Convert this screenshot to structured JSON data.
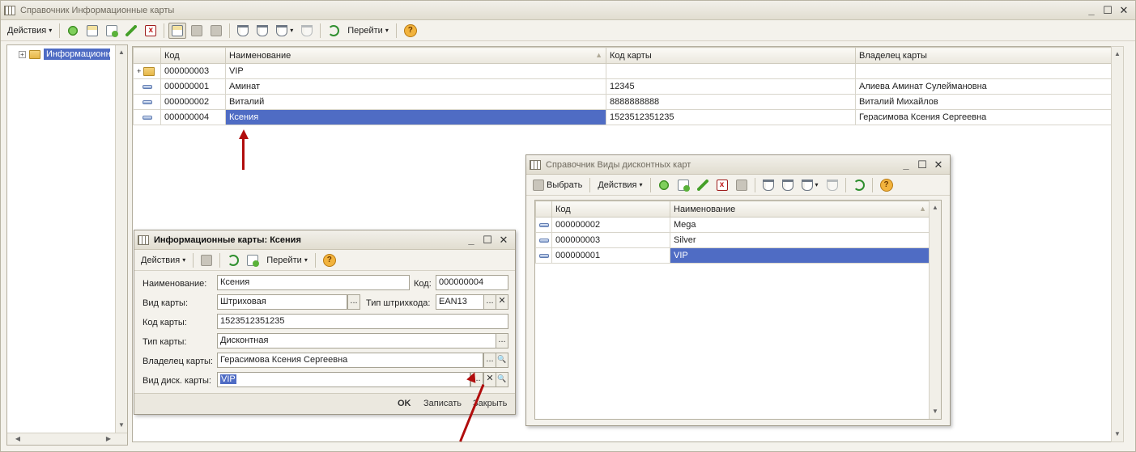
{
  "main": {
    "title": "Справочник Информационные карты",
    "toolbar": {
      "actions_label": "Действия",
      "goto_label": "Перейти",
      "help": "?"
    },
    "tree": {
      "item_label": "Информационные карты",
      "plus": "+"
    },
    "table": {
      "headers": {
        "code": "Код",
        "name": "Наименование",
        "card_code": "Код карты",
        "owner": "Владелец карты"
      },
      "rows": [
        {
          "code": "000000003",
          "name": "VIP",
          "card_code": "",
          "owner": ""
        },
        {
          "code": "000000001",
          "name": "Аминат",
          "card_code": "12345",
          "owner": "Алиева Аминат Сулеймановна"
        },
        {
          "code": "000000002",
          "name": "Виталий",
          "card_code": "8888888888",
          "owner": "Виталий Михайлов"
        },
        {
          "code": "000000004",
          "name": "Ксения",
          "card_code": "1523512351235",
          "owner": "Герасимова Ксения Сергеевна"
        }
      ]
    }
  },
  "form": {
    "title": "Информационные карты: Ксения",
    "toolbar": {
      "actions_label": "Действия",
      "goto_label": "Перейти",
      "help": "?"
    },
    "fields": {
      "name_label": "Наименование:",
      "name_value": "Ксения",
      "code_label": "Код:",
      "code_value": "000000004",
      "card_kind_label": "Вид карты:",
      "card_kind_value": "Штриховая",
      "barcode_type_label": "Тип штрихкода:",
      "barcode_type_value": "EAN13",
      "card_code_label": "Код карты:",
      "card_code_value": "1523512351235",
      "card_type_label": "Тип карты:",
      "card_type_value": "Дисконтная",
      "owner_label": "Владелец карты:",
      "owner_value": "Герасимова Ксения Сергеевна",
      "disc_kind_label": "Вид диск. карты:",
      "disc_kind_value": "VIP"
    },
    "footer": {
      "ok": "OK",
      "save": "Записать",
      "close": "Закрыть"
    }
  },
  "disc": {
    "title": "Справочник Виды дисконтных карт",
    "toolbar": {
      "select_label": "Выбрать",
      "actions_label": "Действия",
      "help": "?"
    },
    "table": {
      "headers": {
        "code": "Код",
        "name": "Наименование"
      },
      "rows": [
        {
          "code": "000000002",
          "name": "Mega"
        },
        {
          "code": "000000003",
          "name": "Silver"
        },
        {
          "code": "000000001",
          "name": "VIP"
        }
      ]
    }
  },
  "glyphs": {
    "minimize": "_",
    "maximize": "☐",
    "close": "✕",
    "dots": "...",
    "clear": "✕",
    "search": "🔍",
    "caret": "▾",
    "scroll_up": "▲",
    "scroll_down": "▼",
    "scroll_left": "◀",
    "scroll_right": "▶",
    "expand": "+",
    "sort": "▲"
  },
  "colors": {
    "selection": "#4f6cc4",
    "arrow": "#b10d0d"
  }
}
